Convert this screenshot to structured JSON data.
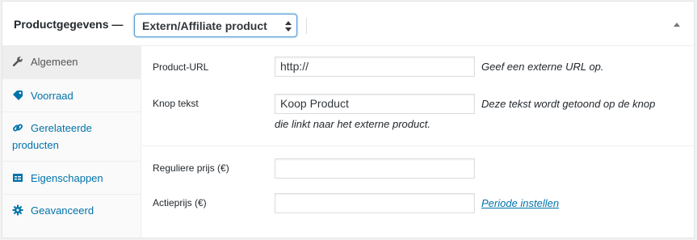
{
  "header": {
    "title": "Productgegevens —",
    "product_type": "Extern/Affiliate product"
  },
  "tabs": [
    {
      "label": "Algemeen",
      "icon": "wrench-icon"
    },
    {
      "label": "Voorraad",
      "icon": "tag-icon"
    },
    {
      "label": "Gerelateerde\nproducten",
      "icon": "link-icon"
    },
    {
      "label": "Eigenschappen",
      "icon": "table-icon"
    },
    {
      "label": "Geavanceerd",
      "icon": "gear-icon"
    }
  ],
  "fields": {
    "product_url": {
      "label": "Product-URL",
      "value": "http://",
      "description": "Geef een externe URL op."
    },
    "button_text": {
      "label": "Knop tekst",
      "value": "Koop Product",
      "description_line1": "Deze tekst wordt getoond op de knop",
      "description_line2": "die linkt naar het externe product."
    },
    "regular_price": {
      "label": "Reguliere prijs (€)",
      "value": ""
    },
    "sale_price": {
      "label": "Actieprijs (€)",
      "value": "",
      "schedule_link": "Periode instellen"
    }
  },
  "colors": {
    "link": "#0073aa",
    "active_tab_bg": "#eeeeee",
    "focus": "#5b9dd9"
  }
}
